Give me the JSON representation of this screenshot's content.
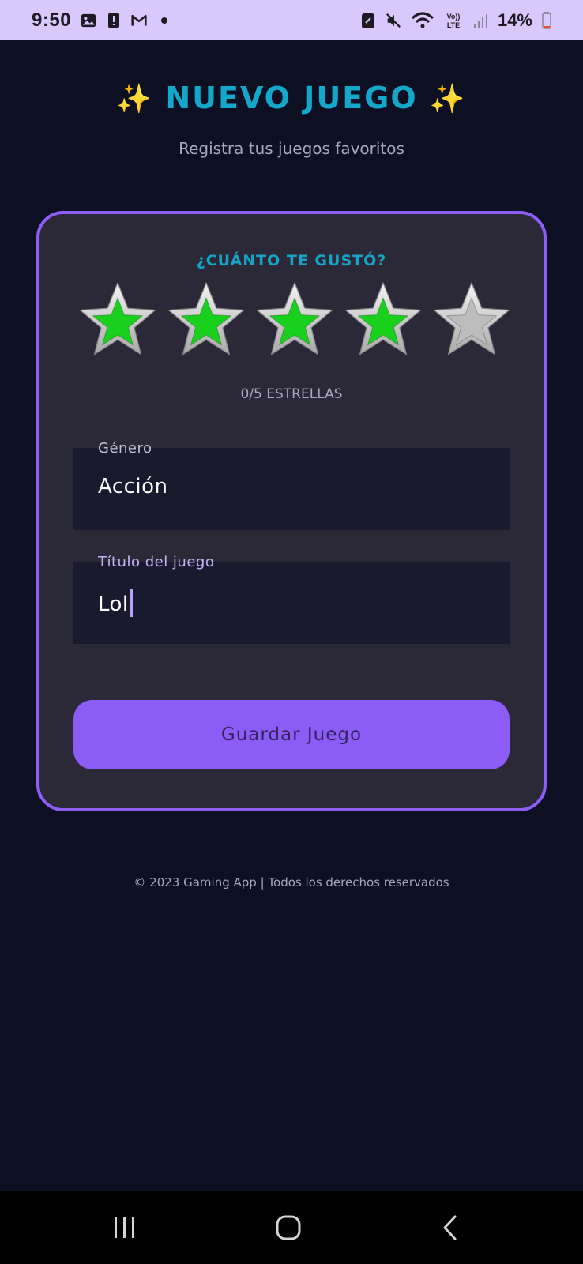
{
  "status_bar": {
    "time": "9:50",
    "battery": "14%",
    "icons": [
      "image-icon",
      "alert-icon",
      "gmail-icon",
      "dot-icon",
      "battery-saver-icon",
      "mute-icon",
      "wifi-icon",
      "volte-icon",
      "signal-icon",
      "battery-icon"
    ]
  },
  "header": {
    "title": "NUEVO JUEGO",
    "sparkle": "✨",
    "subtitle": "Registra tus juegos favoritos"
  },
  "card": {
    "rating_question": "¿CUÁNTO TE GUSTÓ?",
    "stars_filled": 4,
    "stars_total": 5,
    "rating_count": "0/5 ESTRELLAS",
    "colors": {
      "star_filled": "#19d11c",
      "star_empty": "#bdbdbd",
      "border": "#8f5cf6"
    }
  },
  "form": {
    "genre": {
      "label": "Género",
      "value": "Acción"
    },
    "title": {
      "label": "Título del juego",
      "value": "Lol"
    }
  },
  "save_button": {
    "label": "Guardar Juego"
  },
  "footer": {
    "text": "© 2023 Gaming App | Todos los derechos reservados"
  },
  "nav": {
    "icons": [
      "recent-apps-icon",
      "home-icon",
      "back-icon"
    ]
  },
  "colors": {
    "background": "#0d0f23",
    "accent": "#13a7c9",
    "primary": "#8b5cf6"
  }
}
